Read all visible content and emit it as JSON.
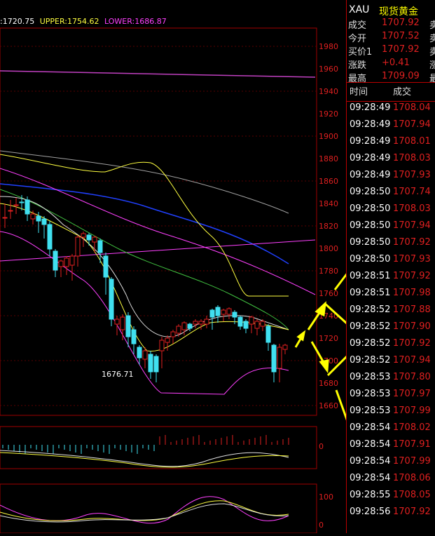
{
  "legend": {
    "mid": ":1720.75",
    "upper": "UPPER:1754.62",
    "lower": "LOWER:1686.87"
  },
  "y_axis_labels": [
    "1980",
    "1960",
    "1940",
    "1920",
    "1900",
    "1880",
    "1860",
    "1840",
    "1820",
    "1800",
    "1780",
    "1760",
    "1740",
    "1720",
    "1700",
    "1680",
    "1660"
  ],
  "low_annotation": "1676.71",
  "macd_zero_label": "0",
  "osc_labels": [
    "100",
    "0"
  ],
  "symbol": {
    "code": "XAU",
    "name": "现货黄金"
  },
  "quote": [
    {
      "label": "成交",
      "value": "1707.92",
      "side": "卖"
    },
    {
      "label": "今开",
      "value": "1707.52",
      "side": "卖"
    },
    {
      "label": "买价1",
      "value": "1707.92",
      "side": "卖"
    },
    {
      "label": "涨跌",
      "value": "+0.41",
      "side": "涨"
    },
    {
      "label": "最高",
      "value": "1709.09",
      "side": "最"
    }
  ],
  "ticks_header": {
    "time": "时间",
    "price": "成交"
  },
  "ticks": [
    {
      "time": "09:28:49",
      "price": "1708.04"
    },
    {
      "time": "09:28:49",
      "price": "1707.94"
    },
    {
      "time": "09:28:49",
      "price": "1708.01"
    },
    {
      "time": "09:28:49",
      "price": "1708.03"
    },
    {
      "time": "09:28:49",
      "price": "1707.93"
    },
    {
      "time": "09:28:50",
      "price": "1707.74"
    },
    {
      "time": "09:28:50",
      "price": "1708.03"
    },
    {
      "time": "09:28:50",
      "price": "1707.94"
    },
    {
      "time": "09:28:50",
      "price": "1707.92"
    },
    {
      "time": "09:28:50",
      "price": "1707.93"
    },
    {
      "time": "09:28:51",
      "price": "1707.92"
    },
    {
      "time": "09:28:51",
      "price": "1707.98"
    },
    {
      "time": "09:28:52",
      "price": "1707.88"
    },
    {
      "time": "09:28:52",
      "price": "1707.90"
    },
    {
      "time": "09:28:52",
      "price": "1707.92"
    },
    {
      "time": "09:28:52",
      "price": "1707.94"
    },
    {
      "time": "09:28:53",
      "price": "1707.80"
    },
    {
      "time": "09:28:53",
      "price": "1707.97"
    },
    {
      "time": "09:28:53",
      "price": "1707.99"
    },
    {
      "time": "09:28:54",
      "price": "1708.02"
    },
    {
      "time": "09:28:54",
      "price": "1707.91"
    },
    {
      "time": "09:28:54",
      "price": "1707.99"
    },
    {
      "time": "09:28:54",
      "price": "1708.06"
    },
    {
      "time": "09:28:55",
      "price": "1708.05"
    },
    {
      "time": "09:28:56",
      "price": "1707.92"
    }
  ],
  "colors": {
    "up": "#e02020",
    "down": "#40e0f0",
    "grid": "#8b0000",
    "upper": "#ffff40",
    "lower": "#ff40ff",
    "arrow": "#ffff00"
  }
}
